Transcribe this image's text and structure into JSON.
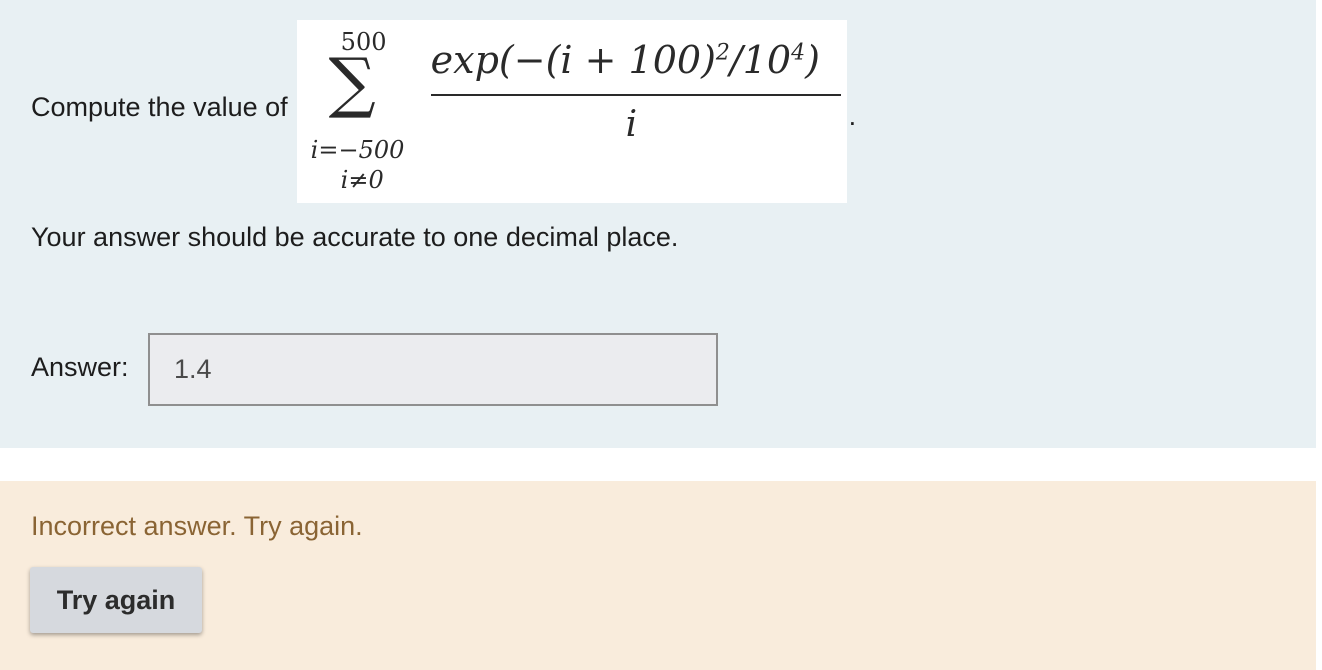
{
  "question": {
    "prompt": "Compute the value of",
    "formula": {
      "sum_upper": "500",
      "sum_sign": "∑",
      "sum_lower_1": "i=−500",
      "sum_lower_2": "i≠0",
      "numerator_main": "exp(−(i + 100)",
      "numerator_exp1": "2",
      "numerator_mid": "/10",
      "numerator_exp2": "4",
      "numerator_end": ")",
      "denominator": "i"
    },
    "trailing_period": ".",
    "instruction": "Your answer should be accurate to one decimal place.",
    "answer_label": "Answer:",
    "answer_value": "1.4"
  },
  "feedback": {
    "message": "Incorrect answer. Try again.",
    "button_label": "Try again"
  },
  "colors": {
    "question_bg": "#e8f0f3",
    "feedback_bg": "#f9ecdc",
    "feedback_text": "#8a6434"
  }
}
